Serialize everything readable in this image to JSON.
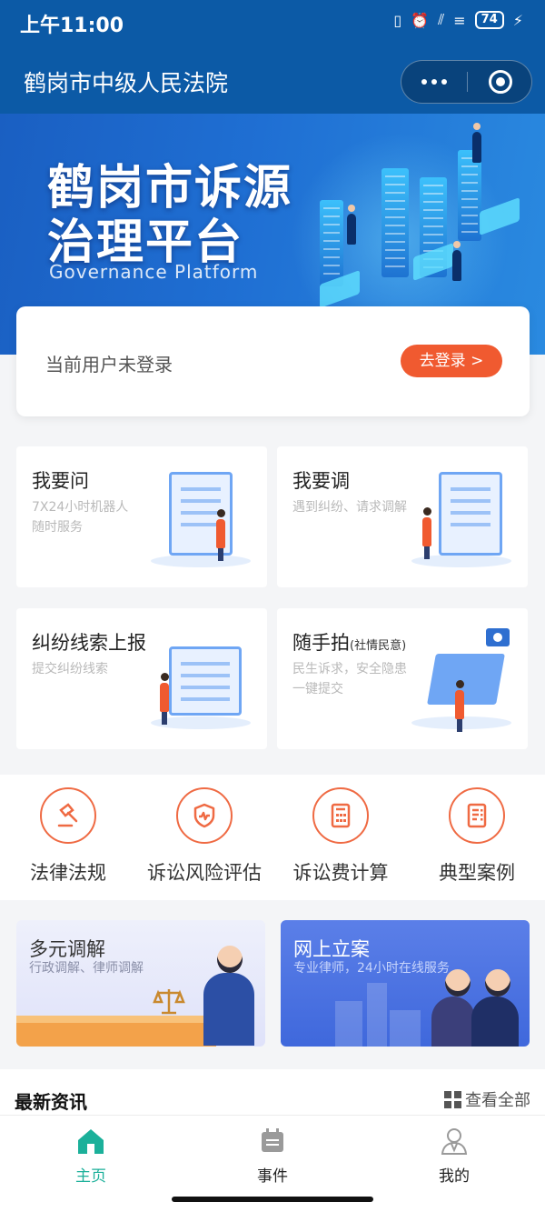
{
  "status_bar": {
    "time": "上午11:00",
    "battery": "74"
  },
  "header": {
    "title": "鹤岗市中级人民法院",
    "accent_color": "#0c5aa6"
  },
  "banner": {
    "title_line1": "鹤岗市诉源",
    "title_line2": "治理平台",
    "subtitle": "Governance Platform"
  },
  "login": {
    "message": "当前用户未登录",
    "button_label": "去登录 >",
    "button_color": "#f05a30"
  },
  "services": [
    {
      "title": "我要问",
      "note": "",
      "desc_line1": "7X24小时机器人",
      "desc_line2": "随时服务"
    },
    {
      "title": "我要调",
      "note": "",
      "desc_line1": "遇到纠纷、请求调解",
      "desc_line2": ""
    },
    {
      "title": "纠纷线索上报",
      "note": "",
      "desc_line1": "提交纠纷线索",
      "desc_line2": ""
    },
    {
      "title": "随手拍",
      "note": "(社情民意)",
      "desc_line1": "民生诉求，安全隐患",
      "desc_line2": "一键提交"
    }
  ],
  "quick_links": [
    {
      "label": "法律法规",
      "icon": "gavel-icon"
    },
    {
      "label": "诉讼风险评估",
      "icon": "shield-icon"
    },
    {
      "label": "诉讼费计算",
      "icon": "calculator-icon"
    },
    {
      "label": "典型案例",
      "icon": "case-document-icon"
    }
  ],
  "promos": [
    {
      "title": "多元调解",
      "subtitle": "行政调解、律师调解"
    },
    {
      "title": "网上立案",
      "subtitle": "专业律师，24小时在线服务"
    }
  ],
  "news": {
    "title": "最新资讯",
    "view_all": "查看全部"
  },
  "tabbar": {
    "active_color": "#1bb09a",
    "items": [
      {
        "label": "主页",
        "icon": "home-icon"
      },
      {
        "label": "事件",
        "icon": "calendar-icon"
      },
      {
        "label": "我的",
        "icon": "user-icon"
      }
    ]
  }
}
